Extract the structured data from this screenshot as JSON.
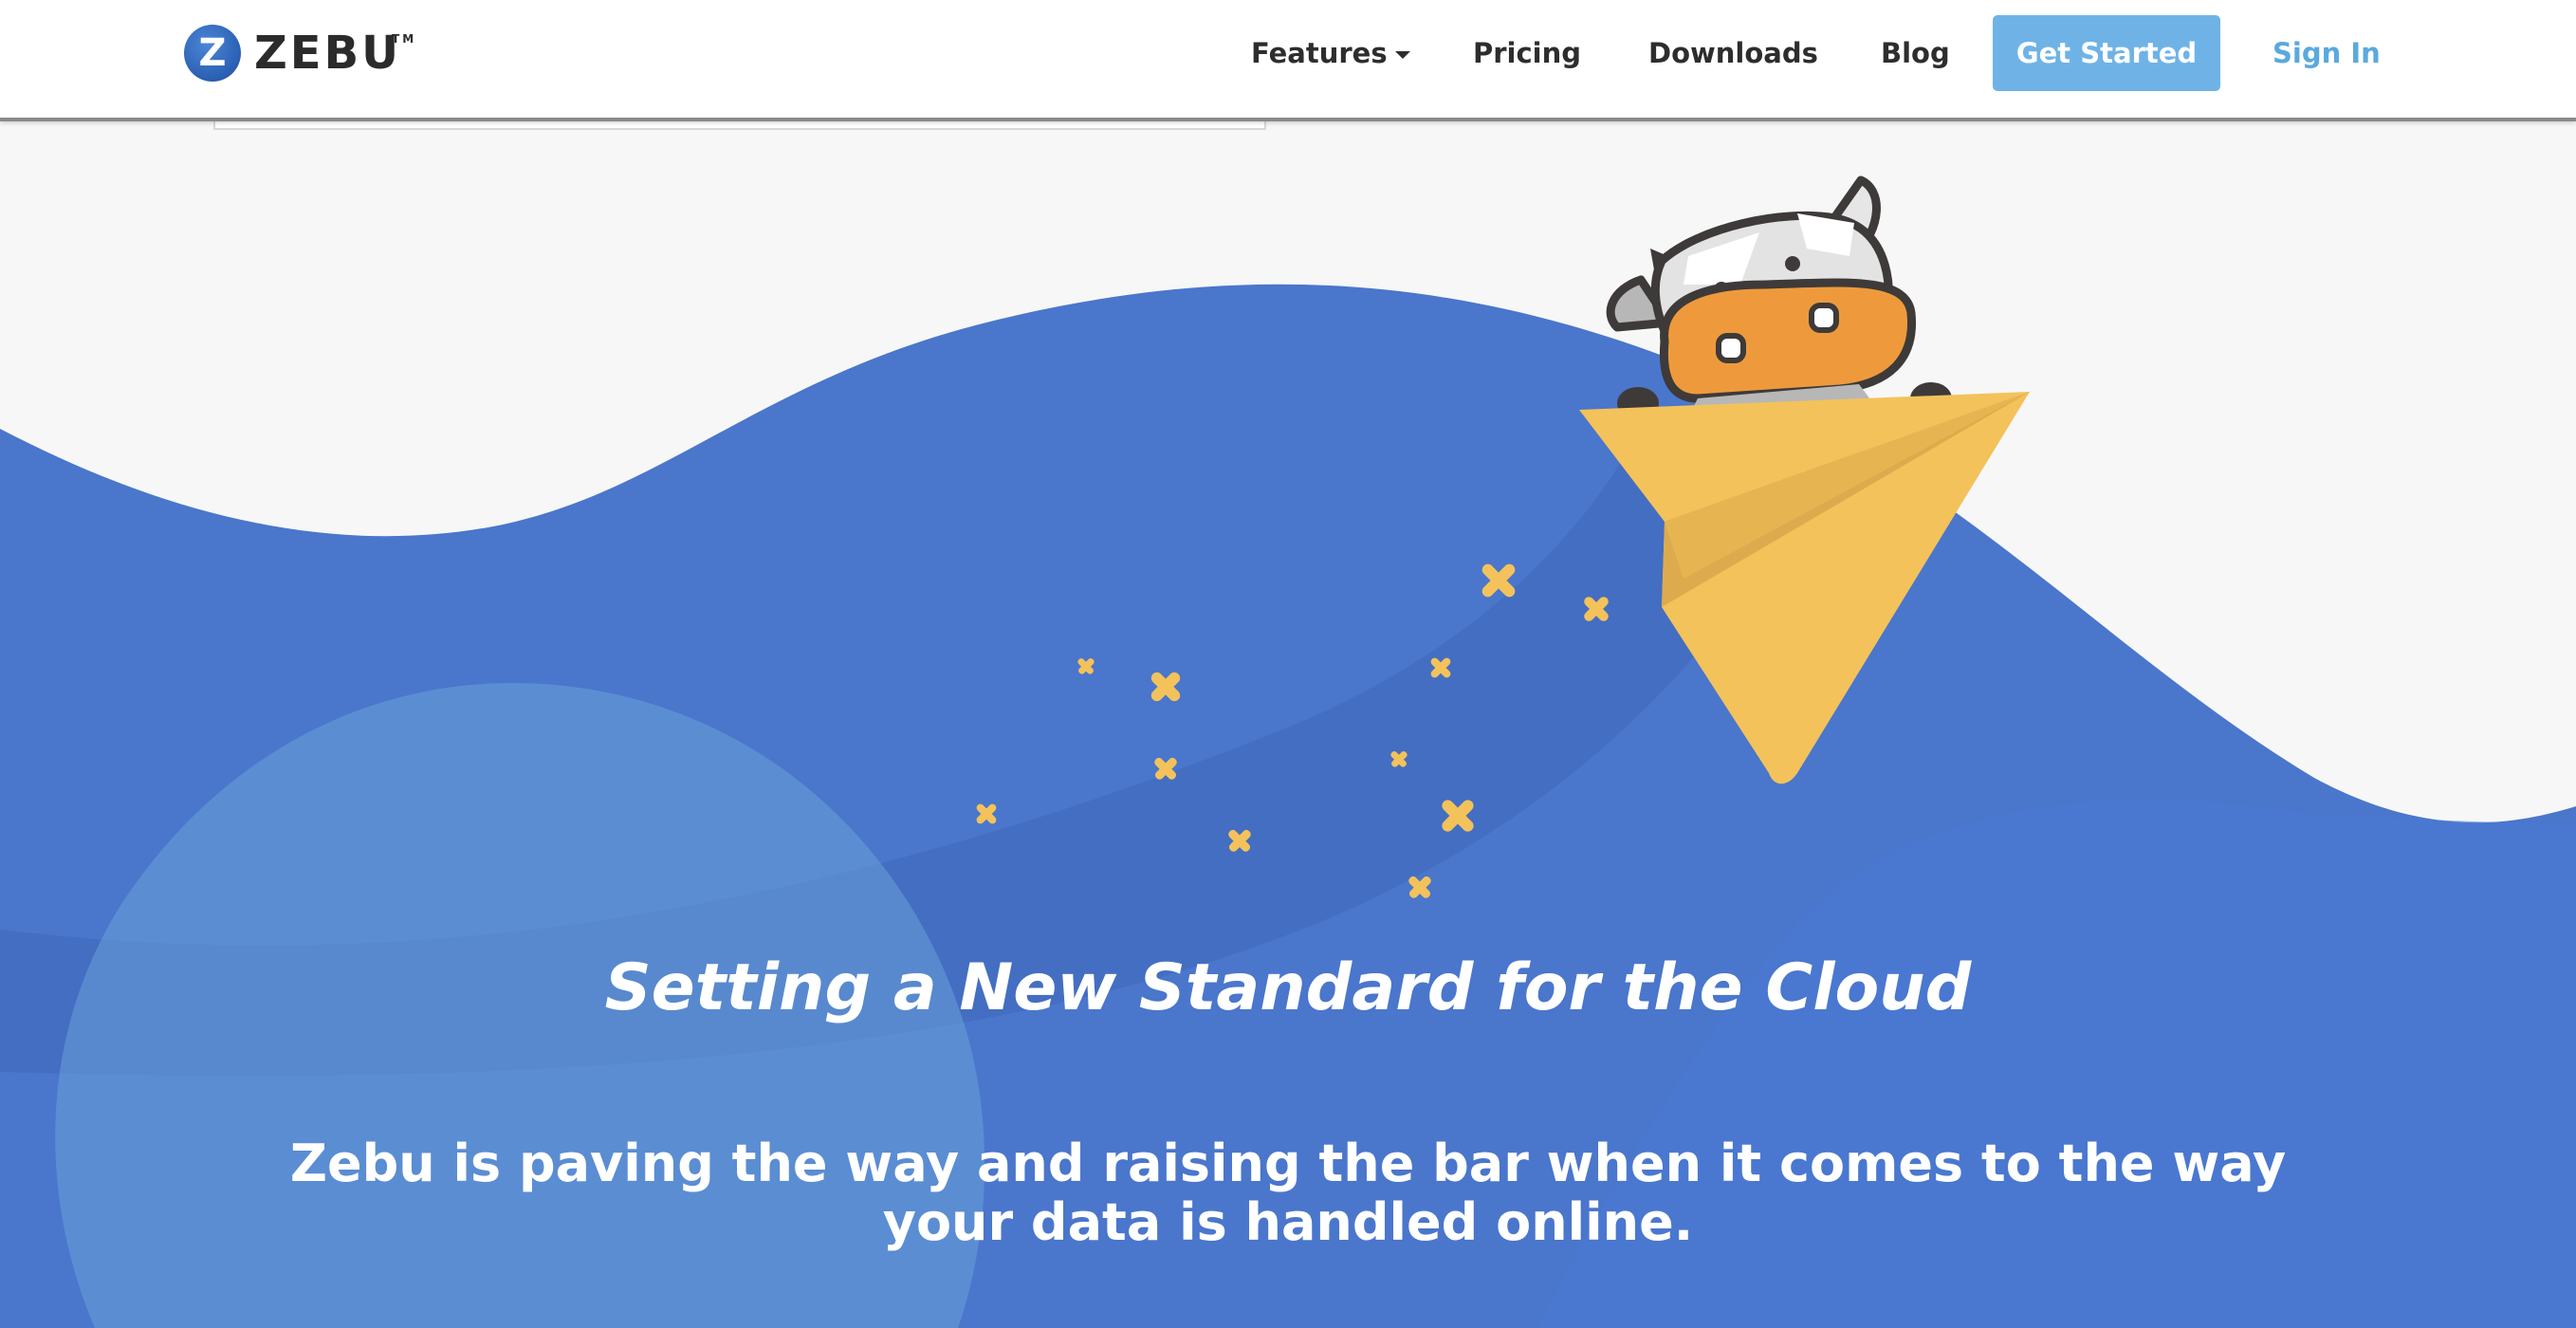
{
  "header": {
    "logo_text": "ZEBU",
    "logo_mark": "Z",
    "logo_tm": "TM",
    "nav": {
      "features": "Features",
      "pricing": "Pricing",
      "downloads": "Downloads",
      "blog": "Blog"
    },
    "get_started": "Get Started",
    "sign_in": "Sign In"
  },
  "hero": {
    "title": "Setting a New Standard for the Cloud",
    "subtitle": "Zebu is paving the way and raising the bar when it comes to the way your data is handled online.",
    "illustration": "cow-riding-paper-plane"
  },
  "colors": {
    "brand_blue": "#4a76cc",
    "button_blue": "#6fb3e6",
    "sign_in_blue": "#5aa9df",
    "plane_yellow": "#f3c25b",
    "cow_orange": "#ee9a3c",
    "background": "#f7f7f7"
  }
}
